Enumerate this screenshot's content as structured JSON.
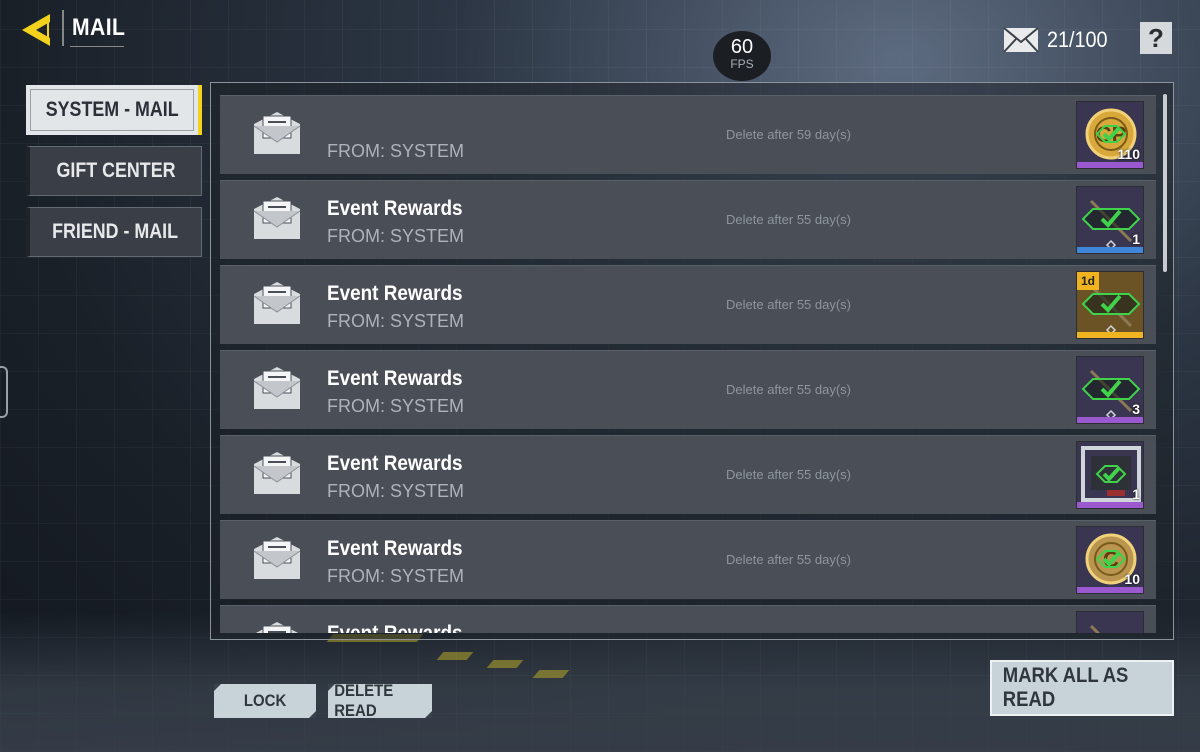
{
  "header": {
    "title": "MAIL",
    "mail_count": "21/100",
    "help_label": "?"
  },
  "fps": {
    "value": "60",
    "label": "FPS"
  },
  "nav": [
    {
      "label": "SYSTEM - MAIL",
      "active": true
    },
    {
      "label": "GIFT CENTER",
      "active": false
    },
    {
      "label": "FRIEND - MAIL",
      "active": false
    }
  ],
  "mails": [
    {
      "subject": "",
      "from": "FROM: SYSTEM",
      "expiry": "Delete after 59 day(s)",
      "reward": {
        "icon": "cp-coin-icon",
        "qty": "110",
        "rarity_color": "#9b59d0",
        "tag": ""
      }
    },
    {
      "subject": "Event Rewards",
      "from": "FROM: SYSTEM",
      "expiry": "Delete after 55 day(s)",
      "reward": {
        "icon": "weapon-icon",
        "qty": "1",
        "rarity_color": "#3f86d8",
        "tag": ""
      }
    },
    {
      "subject": "Event Rewards",
      "from": "FROM: SYSTEM",
      "expiry": "Delete after 55 day(s)",
      "reward": {
        "icon": "weapon-icon",
        "qty": "",
        "rarity_color": "#f0b420",
        "tag": "1d"
      }
    },
    {
      "subject": "Event Rewards",
      "from": "FROM: SYSTEM",
      "expiry": "Delete after 55 day(s)",
      "reward": {
        "icon": "weapon-icon",
        "qty": "3",
        "rarity_color": "#9b59d0",
        "tag": ""
      }
    },
    {
      "subject": "Event Rewards",
      "from": "FROM: SYSTEM",
      "expiry": "Delete after 55 day(s)",
      "reward": {
        "icon": "frame-icon",
        "qty": "1",
        "rarity_color": "#9b59d0",
        "tag": ""
      }
    },
    {
      "subject": "Event Rewards",
      "from": "FROM: SYSTEM",
      "expiry": "Delete after 55 day(s)",
      "reward": {
        "icon": "cod-coin-icon",
        "qty": "10",
        "rarity_color": "#9b59d0",
        "tag": ""
      }
    },
    {
      "subject": "Event Rewards",
      "from": "",
      "expiry": "",
      "reward": {
        "icon": "weapon-icon",
        "qty": "",
        "rarity_color": "#9b59d0",
        "tag": ""
      }
    }
  ],
  "buttons": {
    "lock": "LOCK",
    "delete_read": "DELETE READ",
    "mark_all": "MARK ALL AS READ"
  },
  "colors": {
    "accent": "#f2d21c",
    "check": "#3fd24a"
  }
}
